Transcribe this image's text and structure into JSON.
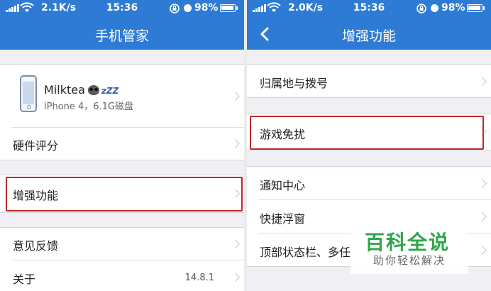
{
  "status": {
    "speed_left": "2.1K/s",
    "speed_right": "2.0K/s",
    "time": "15:36",
    "battery_pct": "98%",
    "battery_level": 0.98
  },
  "left": {
    "title": "手机管家",
    "device": {
      "name": "Milktea",
      "zzz": "zZZ",
      "info": "iPhone 4，6.1G磁盘"
    },
    "items": {
      "hardware": "硬件评分",
      "enhance": "增强功能",
      "feedback": "意见反馈",
      "about": "关于",
      "about_version": "14.8.1"
    }
  },
  "right": {
    "title": "增强功能",
    "items": {
      "location": "归属地与拨号",
      "game": "游戏免扰",
      "notify": "通知中心",
      "float": "快捷浮窗",
      "topbar": "顶部状态栏、多任"
    }
  },
  "watermark": {
    "title": "百科全说",
    "subtitle": "助你轻松解决"
  },
  "colors": {
    "nav": "#2e7bd6",
    "highlight": "#c0282c",
    "watermark": "#2fa64a"
  }
}
